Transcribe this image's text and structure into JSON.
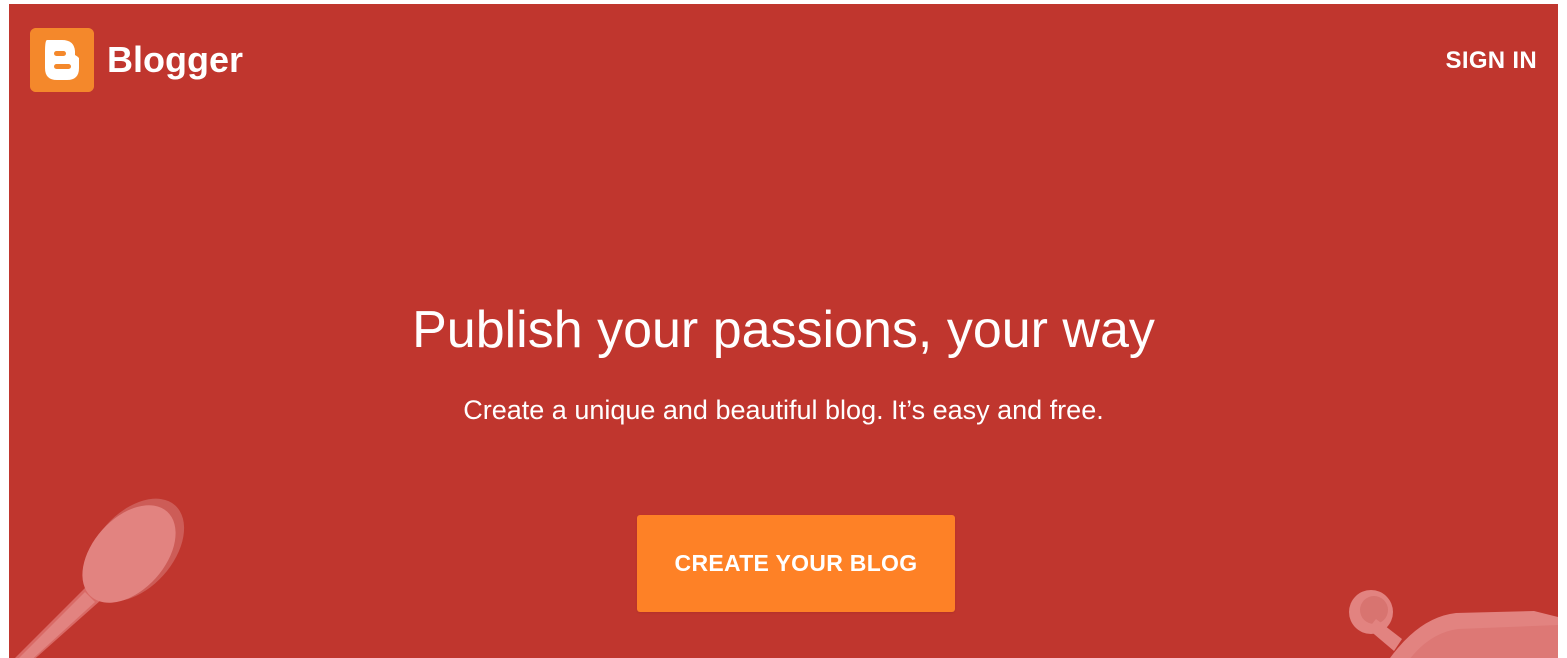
{
  "header": {
    "brand_name": "Blogger",
    "brand_icon": "blogger-b-icon",
    "sign_in_label": "SIGN IN"
  },
  "hero": {
    "headline": "Publish your passions, your way",
    "subheadline": "Create a unique and beautiful blog. It’s easy and free.",
    "cta_label": "CREATE YOUR BLOG"
  },
  "decorations": {
    "left": "wooden-spoon-illustration",
    "right": "rolling-pin-illustration"
  },
  "colors": {
    "background": "#c0362e",
    "brand_orange": "#f4882b",
    "cta_orange": "#fe8126",
    "illustration_pink": "#e28380",
    "text": "#ffffff"
  }
}
